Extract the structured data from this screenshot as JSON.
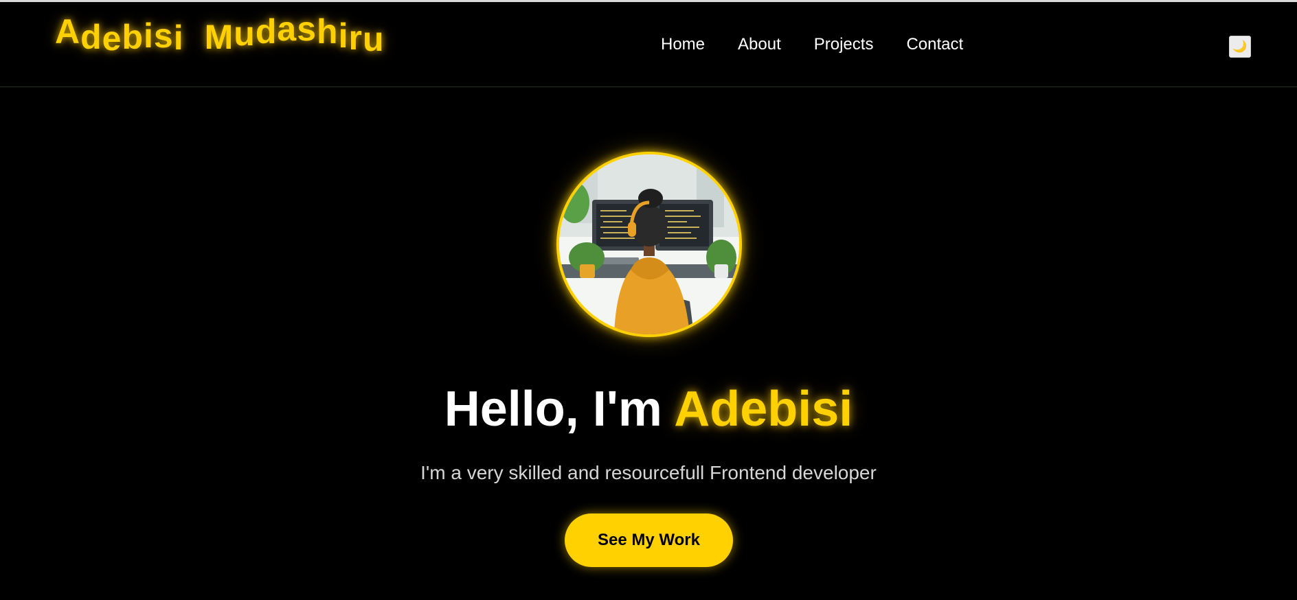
{
  "header": {
    "logo_first": "Adebisi",
    "logo_last": "Mudashiru",
    "nav": [
      {
        "label": "Home"
      },
      {
        "label": "About"
      },
      {
        "label": "Projects"
      },
      {
        "label": "Contact"
      }
    ],
    "theme_toggle_icon": "moon-icon",
    "theme_toggle_glyph": "🌙"
  },
  "hero": {
    "avatar_icon": "developer-illustration",
    "title_prefix": "Hello, I'm ",
    "title_name": "Adebisi",
    "subtitle": "I'm a very skilled and resourcefull Frontend developer",
    "cta_label": "See My Work"
  },
  "colors": {
    "accent": "#ffd100",
    "background": "#000000",
    "text": "#ffffff"
  }
}
